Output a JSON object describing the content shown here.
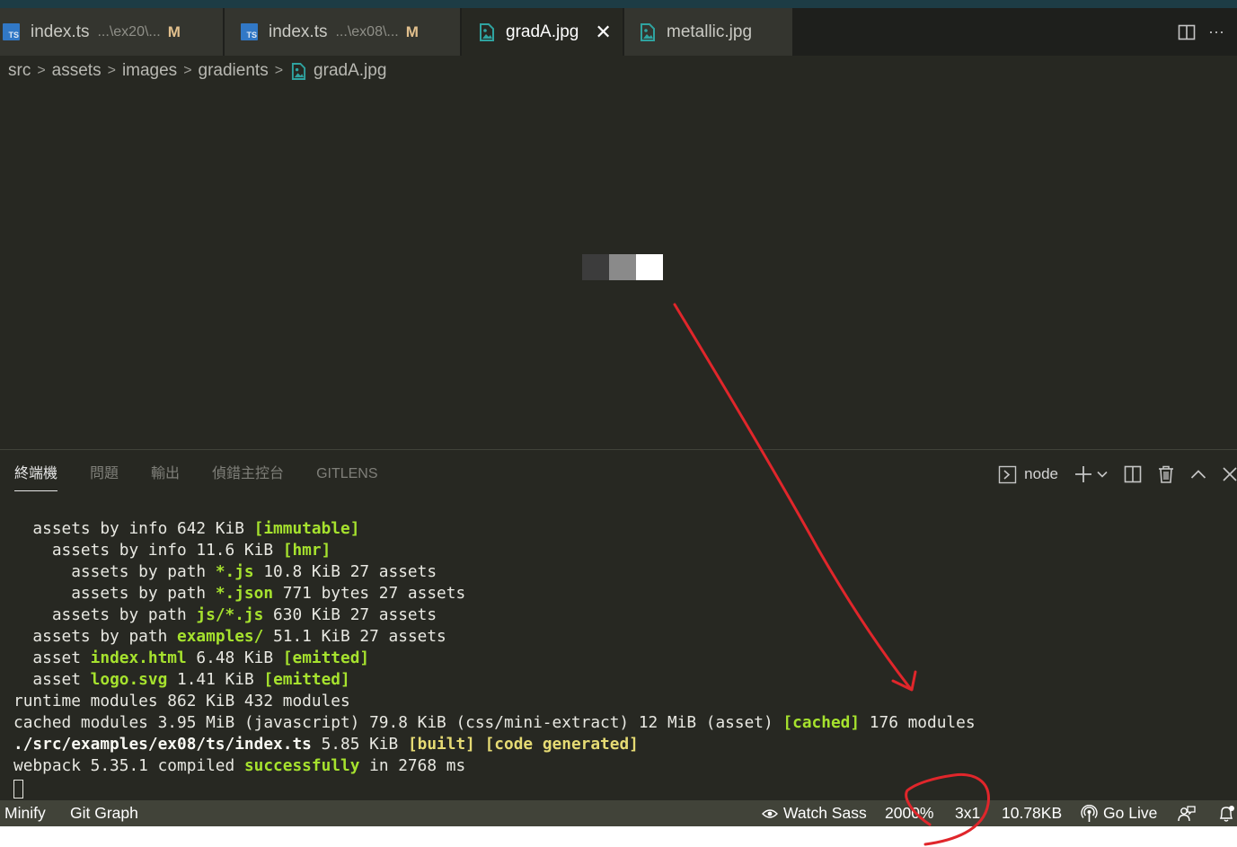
{
  "tabs": [
    {
      "label": "index.ts",
      "description": "...\\ex20\\...",
      "status": "M",
      "icon": "typescript-icon",
      "icon_text": "TS"
    },
    {
      "label": "index.ts",
      "description": "...\\ex08\\...",
      "status": "M",
      "icon": "typescript-icon",
      "icon_text": "TS"
    },
    {
      "label": "gradA.jpg",
      "icon": "image-file-icon",
      "close": "✕",
      "active": true
    },
    {
      "label": "metallic.jpg",
      "icon": "image-file-icon"
    }
  ],
  "tab_actions": {
    "split_icon": "split-editor-icon",
    "more_label": "···"
  },
  "breadcrumb": [
    "src",
    "assets",
    "images",
    "gradients",
    "gradA.jpg"
  ],
  "breadcrumb_separator": ">",
  "preview": {
    "pixels": [
      "#3c3c3c",
      "#8a8a8a",
      "#ffffff"
    ]
  },
  "panel": {
    "tabs": [
      "終端機",
      "問題",
      "輸出",
      "偵錯主控台",
      "GITLENS"
    ],
    "active_tab": "終端機",
    "terminal_name": "node",
    "chevron": "⌄"
  },
  "terminal_lines": [
    [
      {
        "t": "  assets by info 642 KiB "
      },
      {
        "t": "[immutable]",
        "c": "g"
      }
    ],
    [
      {
        "t": "    assets by info 11.6 KiB "
      },
      {
        "t": "[hmr]",
        "c": "g"
      }
    ],
    [
      {
        "t": "      assets by path "
      },
      {
        "t": "*.js",
        "c": "g"
      },
      {
        "t": " 10.8 KiB 27 assets"
      }
    ],
    [
      {
        "t": "      assets by path "
      },
      {
        "t": "*.json",
        "c": "g"
      },
      {
        "t": " 771 bytes 27 assets"
      }
    ],
    [
      {
        "t": "    assets by path "
      },
      {
        "t": "js/*.js",
        "c": "g"
      },
      {
        "t": " 630 KiB 27 assets"
      }
    ],
    [
      {
        "t": "  assets by path "
      },
      {
        "t": "examples/",
        "c": "g"
      },
      {
        "t": " 51.1 KiB 27 assets"
      }
    ],
    [
      {
        "t": "  asset "
      },
      {
        "t": "index.html",
        "c": "g"
      },
      {
        "t": " 6.48 KiB "
      },
      {
        "t": "[emitted]",
        "c": "g"
      }
    ],
    [
      {
        "t": "  asset "
      },
      {
        "t": "logo.svg",
        "c": "g"
      },
      {
        "t": " 1.41 KiB "
      },
      {
        "t": "[emitted]",
        "c": "g"
      }
    ],
    [
      {
        "t": "runtime modules 862 KiB 432 modules"
      }
    ],
    [
      {
        "t": "cached modules 3.95 MiB (javascript) 79.8 KiB (css/mini-extract) 12 MiB (asset) "
      },
      {
        "t": "[cached]",
        "c": "g"
      },
      {
        "t": " 176 modules"
      }
    ],
    [
      {
        "t": "./src/examples/ex08/ts/index.ts",
        "c": "w"
      },
      {
        "t": " 5.85 KiB "
      },
      {
        "t": "[built]",
        "c": "y"
      },
      {
        "t": " "
      },
      {
        "t": "[code generated]",
        "c": "y"
      }
    ],
    [
      {
        "t": "webpack 5.35.1 compiled "
      },
      {
        "t": "successfully",
        "c": "g"
      },
      {
        "t": " in 2768 ms"
      }
    ]
  ],
  "statusbar": {
    "minify": "Minify",
    "git_graph": "Git Graph",
    "watch_sass": "Watch Sass",
    "zoom": "2000%",
    "dimensions": "3x1",
    "file_size": "10.78KB",
    "go_live": "Go Live"
  },
  "colors": {
    "annotation": "#e0262b",
    "editor_bg": "#272822",
    "accent_green": "#a6e22e",
    "accent_yellow": "#e6db74"
  }
}
